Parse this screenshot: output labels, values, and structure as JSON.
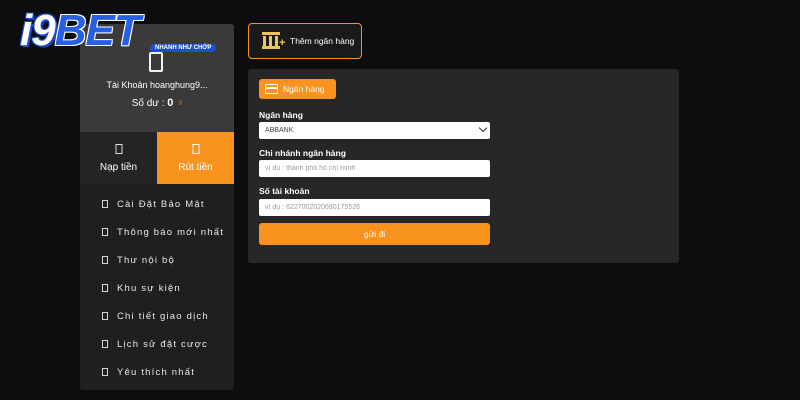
{
  "logo": {
    "brand_prefix": "i9",
    "brand_suffix": "BET",
    "tagline": "NHANH NHƯ CHỚP"
  },
  "profile": {
    "account_label": "Tài Khoản hoanghung9...",
    "balance_label": "Số dư :",
    "balance_value": "0",
    "currency_symbol": "₫"
  },
  "actions": {
    "deposit": "Nạp tiền",
    "withdraw": "Rút tiền"
  },
  "menu": [
    "Cài Đặt Bảo Mật",
    "Thông báo mới nhất",
    "Thư nội bộ",
    "Khu sự kiện",
    "Chi tiết giao dịch",
    "Lịch sử đặt cược",
    "Yêu thích nhất"
  ],
  "add_bank": {
    "label": "Thêm ngân hàng"
  },
  "form": {
    "tab_label": "Ngân hàng",
    "bank_label": "Ngân hàng",
    "bank_selected": "ABBANK",
    "branch_label": "Chi nhánh ngân hàng",
    "branch_placeholder": "ví dụ : thành phố hồ chí minh",
    "account_label": "Số tài khoản",
    "account_placeholder": "ví dụ : 6227002020690175526",
    "submit_label": "gửi đi"
  },
  "colors": {
    "accent": "#f7931e",
    "brand_blue": "#2760e5",
    "background": "#0d0d0d",
    "panel": "#272727"
  }
}
